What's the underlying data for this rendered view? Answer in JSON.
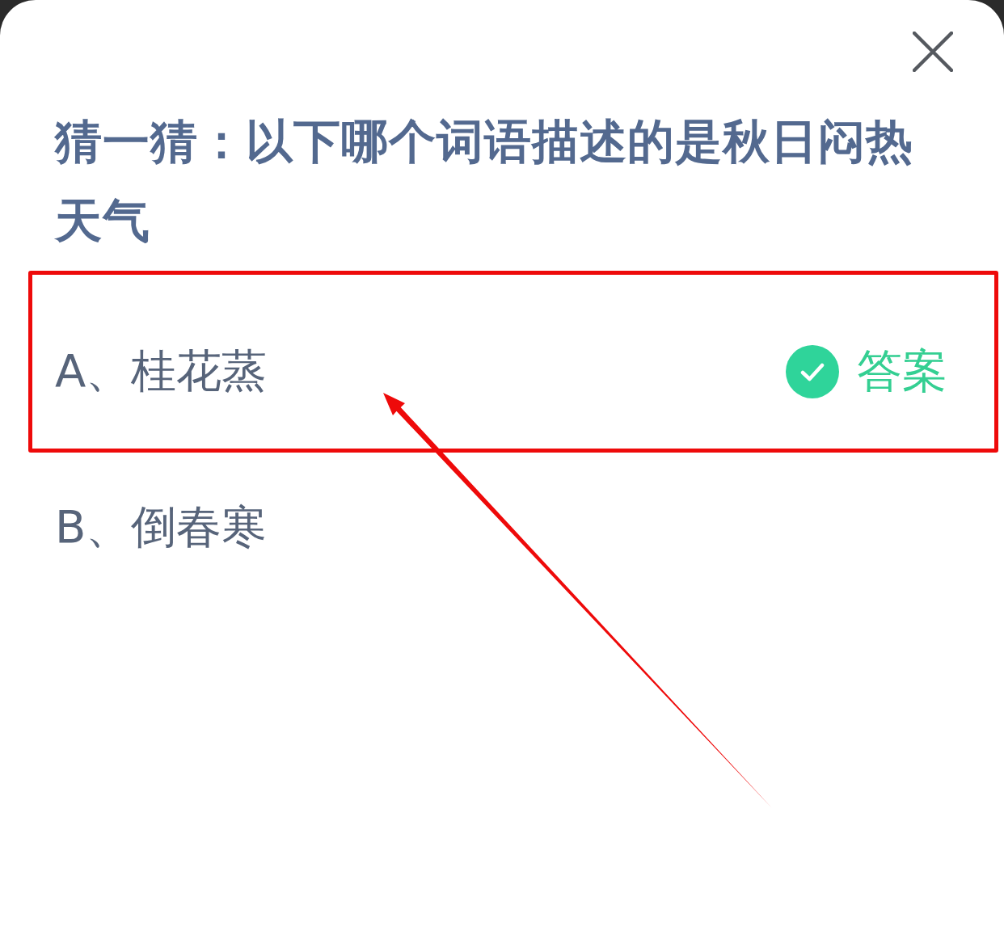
{
  "question": {
    "title": "猜一猜：以下哪个词语描述的是秋日闷热天气"
  },
  "options": [
    {
      "label": "A、桂花蒸",
      "correct": true,
      "answer_badge": "答案",
      "highlighted": true
    },
    {
      "label": "B、倒春寒",
      "correct": false,
      "highlighted": false
    }
  ]
}
